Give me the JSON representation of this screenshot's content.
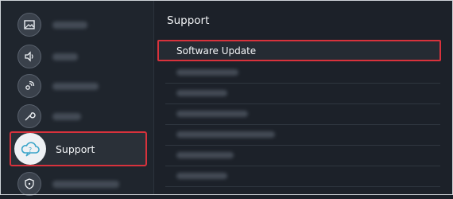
{
  "left_menu": {
    "items": [
      {
        "icon": "picture-icon",
        "label_visible": false
      },
      {
        "icon": "sound-icon",
        "label_visible": false
      },
      {
        "icon": "broadcasting-icon",
        "label_visible": false
      },
      {
        "icon": "general-wrench-icon",
        "label_visible": false
      },
      {
        "icon": "support-cloud-icon",
        "label": "Support",
        "selected": true
      },
      {
        "icon": "shield-icon",
        "label_visible": false
      }
    ]
  },
  "support_panel": {
    "title": "Support",
    "selected_option": "Software Update",
    "other_option_count_visible": 6
  },
  "colors": {
    "highlight_border": "#d8323c",
    "background": "#1c2129",
    "text": "#f1f3f5"
  }
}
